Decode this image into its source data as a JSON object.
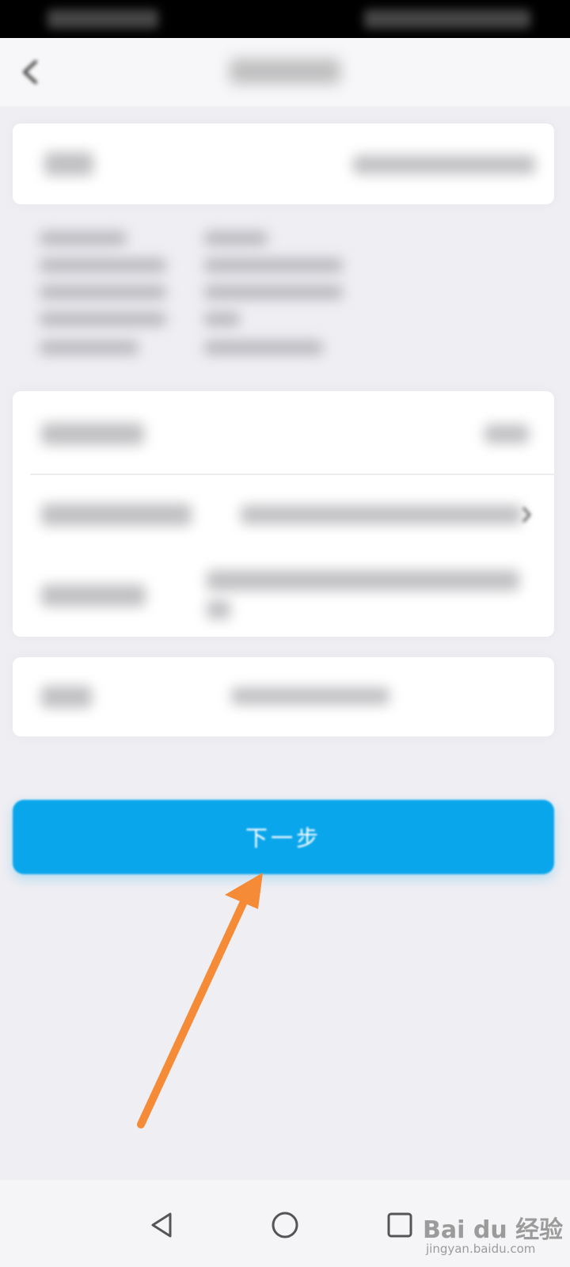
{
  "status_bar": {
    "left_text": "",
    "right_text": ""
  },
  "header": {
    "title": ""
  },
  "card_number": {
    "label": "",
    "value": ""
  },
  "info_lines": [
    {
      "label": "",
      "value": ""
    },
    {
      "label": "",
      "value": ""
    },
    {
      "label": "",
      "value": ""
    },
    {
      "label": "",
      "value": ""
    },
    {
      "label": "",
      "value": ""
    }
  ],
  "form": {
    "row1": {
      "label": "",
      "value": ""
    },
    "row2": {
      "label": "",
      "value": ""
    },
    "row3": {
      "label": "",
      "value": ""
    }
  },
  "phone": {
    "label": "",
    "value": ""
  },
  "next_button": {
    "label": "下一步"
  },
  "watermark": {
    "logo": "Bai du 经验",
    "url": "jingyan.baidu.com"
  },
  "colors": {
    "accent": "#0aa6ec",
    "arrow": "#f58a37",
    "background": "#eeeef3"
  },
  "icons": {
    "back": "back-icon",
    "nav_back": "nav-back-icon",
    "nav_home": "nav-home-icon",
    "nav_recent": "nav-recent-icon"
  }
}
